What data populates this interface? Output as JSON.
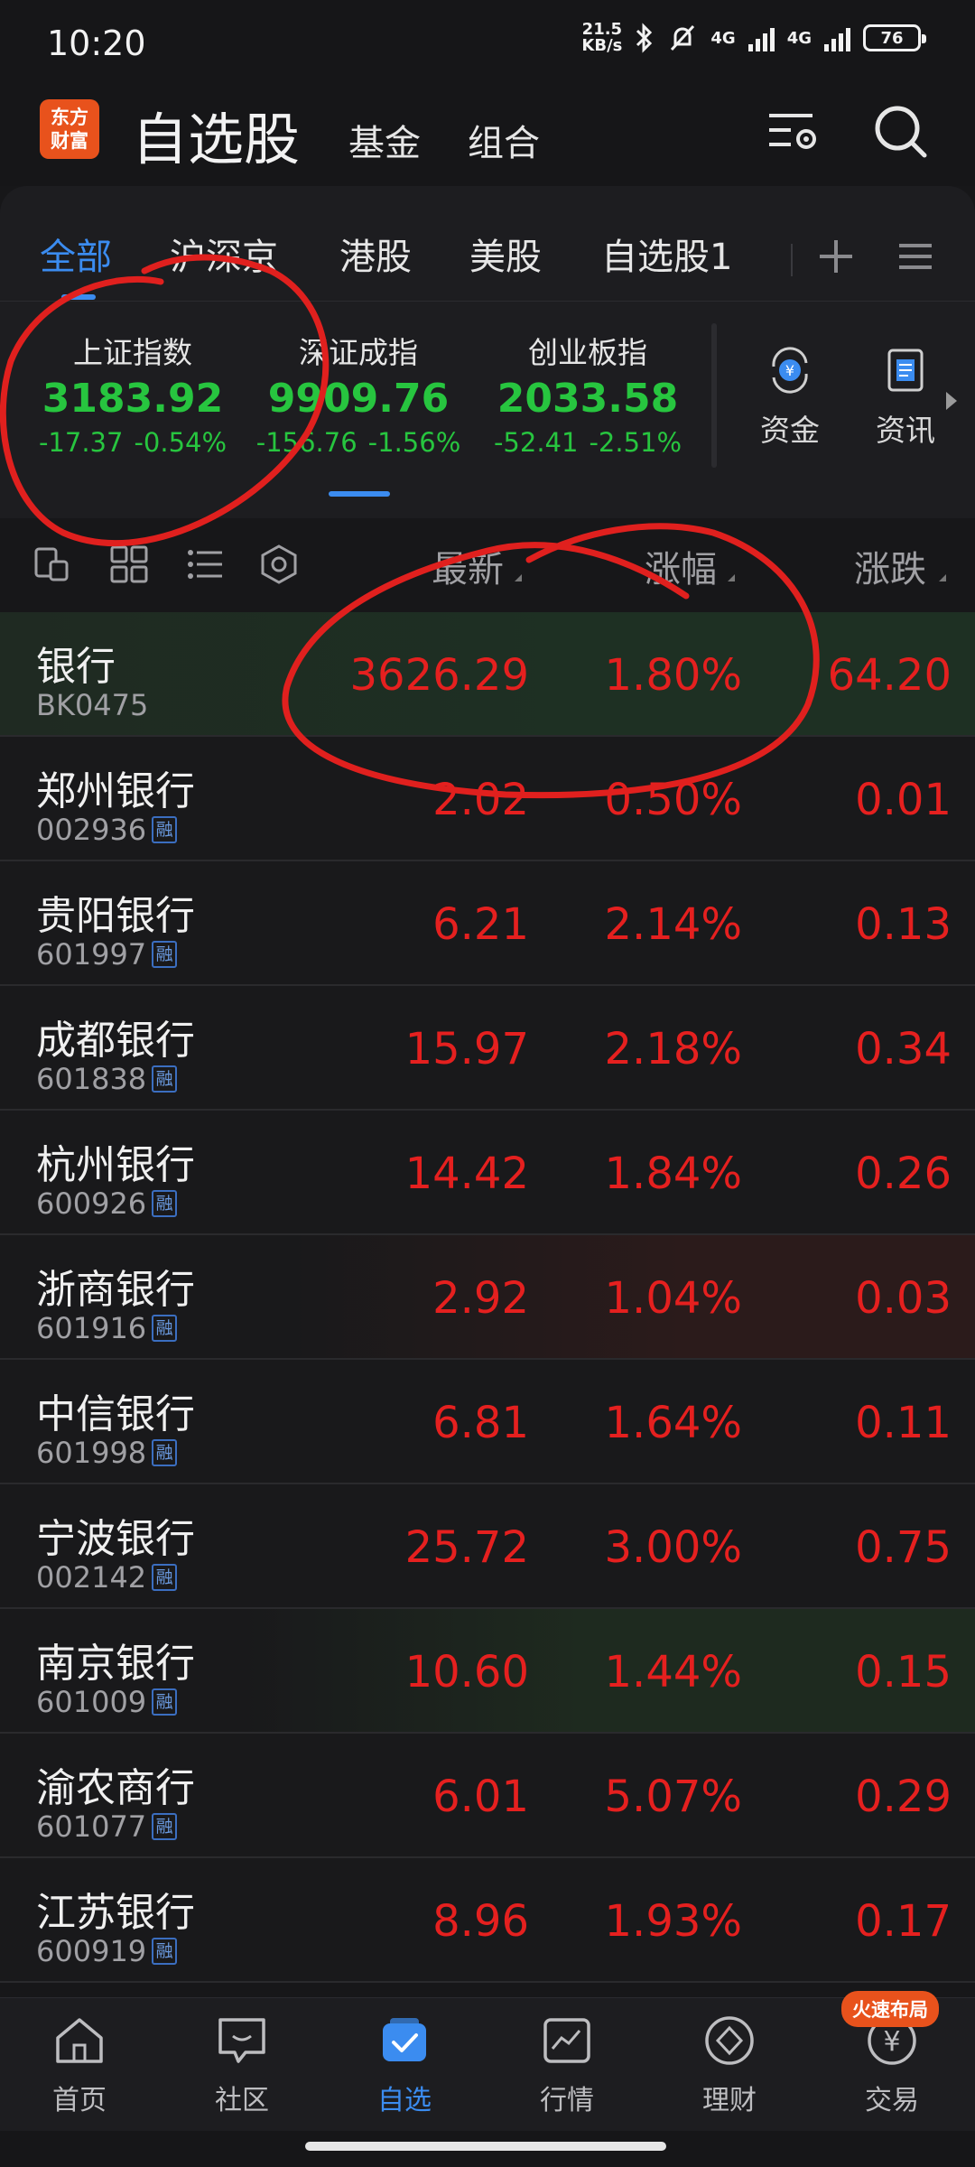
{
  "status_bar": {
    "time": "10:20",
    "net_speed_value": "21.5",
    "net_speed_unit": "KB/s",
    "signal1": "4G",
    "signal2": "4G",
    "battery": "76"
  },
  "header": {
    "logo_line1": "东方",
    "logo_line2": "财富",
    "title": "自选股",
    "tabs": [
      "基金",
      "组合"
    ],
    "settings_icon": "list-settings-icon",
    "search_icon": "search-icon"
  },
  "sub_tabs": {
    "items": [
      "全部",
      "沪深京",
      "港股",
      "美股",
      "自选股1"
    ],
    "active_index": 0,
    "add_icon": "plus-icon",
    "menu_icon": "menu-icon"
  },
  "indices": [
    {
      "name": "上证指数",
      "value": "3183.92",
      "change": "-17.37",
      "pct": "-0.54%"
    },
    {
      "name": "深证成指",
      "value": "9909.76",
      "change": "-156.76",
      "pct": "-1.56%"
    },
    {
      "name": "创业板指",
      "value": "2033.58",
      "change": "-52.41",
      "pct": "-2.51%"
    }
  ],
  "quick_actions": [
    {
      "label": "资金",
      "icon": "yuan-cycle-icon"
    },
    {
      "label": "资讯",
      "icon": "document-icon"
    }
  ],
  "columns": {
    "latest": "最新",
    "pct": "涨幅",
    "change": "涨跌"
  },
  "rong_label": "融",
  "stocks": [
    {
      "name": "银行",
      "code": "BK0475",
      "rong": false,
      "latest": "3626.29",
      "pct": "1.80%",
      "change": "64.20"
    },
    {
      "name": "郑州银行",
      "code": "002936",
      "rong": true,
      "latest": "2.02",
      "pct": "0.50%",
      "change": "0.01"
    },
    {
      "name": "贵阳银行",
      "code": "601997",
      "rong": true,
      "latest": "6.21",
      "pct": "2.14%",
      "change": "0.13"
    },
    {
      "name": "成都银行",
      "code": "601838",
      "rong": true,
      "latest": "15.97",
      "pct": "2.18%",
      "change": "0.34"
    },
    {
      "name": "杭州银行",
      "code": "600926",
      "rong": true,
      "latest": "14.42",
      "pct": "1.84%",
      "change": "0.26"
    },
    {
      "name": "浙商银行",
      "code": "601916",
      "rong": true,
      "latest": "2.92",
      "pct": "1.04%",
      "change": "0.03"
    },
    {
      "name": "中信银行",
      "code": "601998",
      "rong": true,
      "latest": "6.81",
      "pct": "1.64%",
      "change": "0.11"
    },
    {
      "name": "宁波银行",
      "code": "002142",
      "rong": true,
      "latest": "25.72",
      "pct": "3.00%",
      "change": "0.75"
    },
    {
      "name": "南京银行",
      "code": "601009",
      "rong": true,
      "latest": "10.60",
      "pct": "1.44%",
      "change": "0.15"
    },
    {
      "name": "渝农商行",
      "code": "601077",
      "rong": true,
      "latest": "6.01",
      "pct": "5.07%",
      "change": "0.29"
    },
    {
      "name": "江苏银行",
      "code": "600919",
      "rong": true,
      "latest": "8.96",
      "pct": "1.93%",
      "change": "0.17"
    }
  ],
  "bottom_nav": {
    "items": [
      {
        "label": "首页",
        "icon": "home-icon"
      },
      {
        "label": "社区",
        "icon": "chat-icon"
      },
      {
        "label": "自选",
        "icon": "watchlist-icon"
      },
      {
        "label": "行情",
        "icon": "chart-icon"
      },
      {
        "label": "理财",
        "icon": "wealth-icon"
      },
      {
        "label": "交易",
        "icon": "trade-icon"
      }
    ],
    "active_index": 2,
    "promo": "火速布局"
  },
  "colors": {
    "up": "#e5201f",
    "down": "#27c53f",
    "accent": "#3b8cf0",
    "annotation": "#e0201e"
  }
}
